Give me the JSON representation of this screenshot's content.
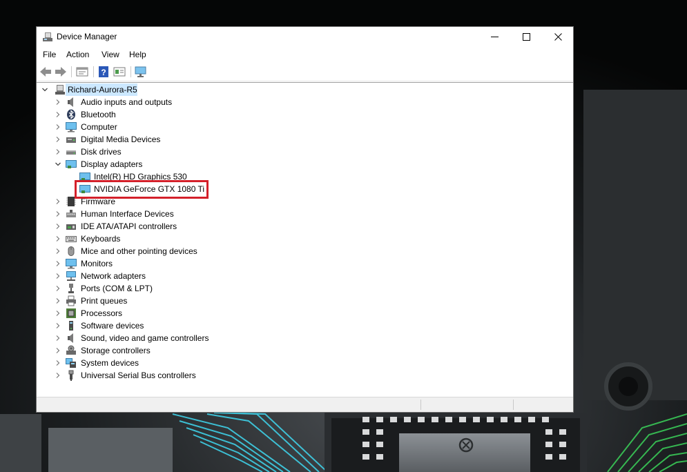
{
  "window": {
    "title": "Device Manager"
  },
  "menu": [
    "File",
    "Action",
    "View",
    "Help"
  ],
  "toolbar": [
    "back",
    "forward",
    "properties",
    "help",
    "update-driver",
    "scan-hardware"
  ],
  "tree": {
    "root": "Richard-Aurora-R5",
    "categories": [
      {
        "label": "Audio inputs and outputs",
        "icon": "speaker-icon",
        "expanded": false
      },
      {
        "label": "Bluetooth",
        "icon": "bluetooth-icon",
        "expanded": false
      },
      {
        "label": "Computer",
        "icon": "computer-icon",
        "expanded": false
      },
      {
        "label": "Digital Media Devices",
        "icon": "media-device-icon",
        "expanded": false
      },
      {
        "label": "Disk drives",
        "icon": "disk-drive-icon",
        "expanded": false
      },
      {
        "label": "Display adapters",
        "icon": "display-adapter-icon",
        "expanded": true,
        "children": [
          "Intel(R) HD Graphics 530",
          "NVIDIA GeForce GTX 1080 Ti"
        ]
      },
      {
        "label": "Firmware",
        "icon": "firmware-icon",
        "expanded": false
      },
      {
        "label": "Human Interface Devices",
        "icon": "hid-icon",
        "expanded": false
      },
      {
        "label": "IDE ATA/ATAPI controllers",
        "icon": "ide-controller-icon",
        "expanded": false
      },
      {
        "label": "Keyboards",
        "icon": "keyboard-icon",
        "expanded": false
      },
      {
        "label": "Mice and other pointing devices",
        "icon": "mouse-icon",
        "expanded": false
      },
      {
        "label": "Monitors",
        "icon": "monitor-icon",
        "expanded": false
      },
      {
        "label": "Network adapters",
        "icon": "network-adapter-icon",
        "expanded": false
      },
      {
        "label": "Ports (COM & LPT)",
        "icon": "port-icon",
        "expanded": false
      },
      {
        "label": "Print queues",
        "icon": "printer-icon",
        "expanded": false
      },
      {
        "label": "Processors",
        "icon": "processor-icon",
        "expanded": false
      },
      {
        "label": "Software devices",
        "icon": "software-device-icon",
        "expanded": false
      },
      {
        "label": "Sound, video and game controllers",
        "icon": "sound-controller-icon",
        "expanded": false
      },
      {
        "label": "Storage controllers",
        "icon": "storage-controller-icon",
        "expanded": false
      },
      {
        "label": "System devices",
        "icon": "system-devices-icon",
        "expanded": false
      },
      {
        "label": "Universal Serial Bus controllers",
        "icon": "usb-icon",
        "expanded": false
      }
    ]
  },
  "colors": {
    "selection": "#cce8ff",
    "highlight_outline": "#d4202a",
    "circuit_glow": "#3fd8f0"
  }
}
